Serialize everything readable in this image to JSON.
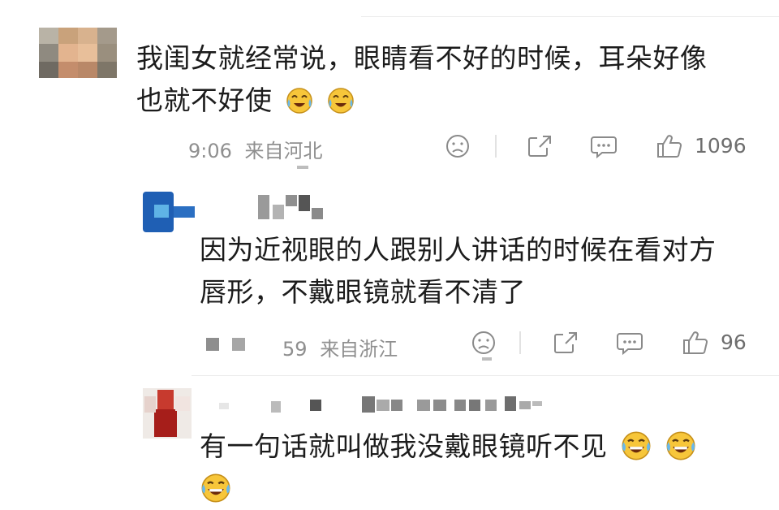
{
  "comments": [
    {
      "text_line1": "我闺女就经常说，眼睛看不好的时候，耳朵好像",
      "text_line2": "也就不好使",
      "emoji": [
        "cry-laugh-icon",
        "cry-laugh-icon"
      ],
      "time": "9:06",
      "location": "来自河北",
      "likes": "1096"
    },
    {
      "text_line1": "因为近视眼的人跟别人讲话的时候在看对方",
      "text_line2": "唇形，不戴眼镜就看不清了",
      "time": "59",
      "location": "来自浙江",
      "likes": "96"
    },
    {
      "text_line1": "有一句话就叫做我没戴眼镜听不见",
      "emoji": [
        "grin-tears-icon",
        "grin-tears-icon",
        "grin-tears-icon"
      ]
    }
  ],
  "colors": {
    "text": "#1c1c1c",
    "meta": "#8f8f8f",
    "icon": "#8a8a8a",
    "emoji_face": "#f7c63a"
  }
}
